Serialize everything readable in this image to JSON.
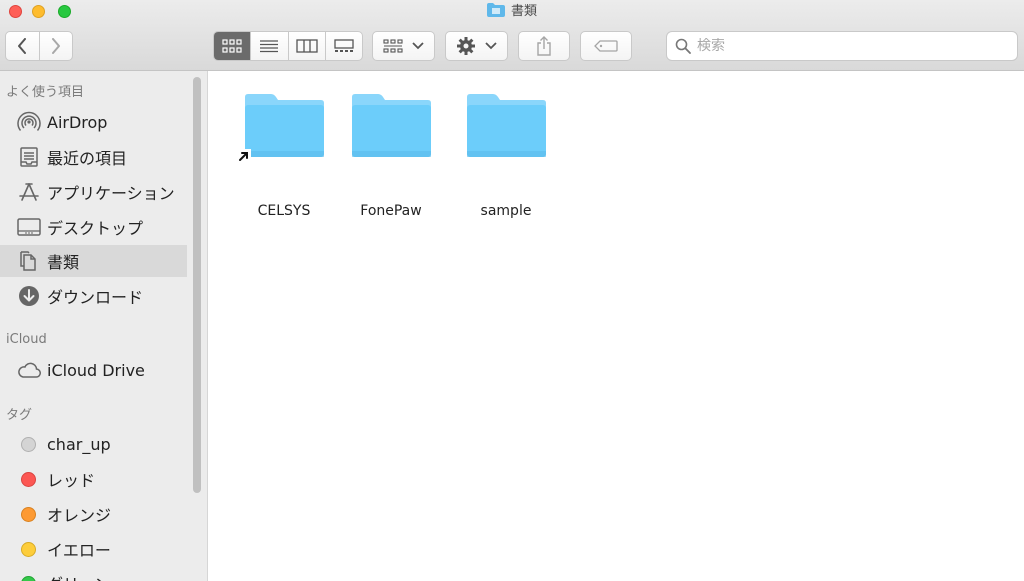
{
  "window": {
    "title": "書類"
  },
  "toolbar": {
    "back_icon": "chevron-left-icon",
    "forward_icon": "chevron-right-icon",
    "views": [
      "icon-view",
      "list-view",
      "column-view",
      "gallery-view"
    ],
    "search_placeholder": "検索"
  },
  "sidebar": {
    "favorites_header": "よく使う項目",
    "favorites": [
      {
        "label": "AirDrop",
        "icon": "airdrop-icon"
      },
      {
        "label": "最近の項目",
        "icon": "recents-icon"
      },
      {
        "label": "アプリケーション",
        "icon": "applications-icon"
      },
      {
        "label": "デスクトップ",
        "icon": "desktop-icon"
      },
      {
        "label": "書類",
        "icon": "documents-icon",
        "selected": true
      },
      {
        "label": "ダウンロード",
        "icon": "downloads-icon"
      }
    ],
    "icloud_header": "iCloud",
    "icloud": [
      {
        "label": "iCloud Drive",
        "icon": "cloud-icon"
      }
    ],
    "tags_header": "タグ",
    "tags": [
      {
        "label": "char_up",
        "color": "#d4d4d4"
      },
      {
        "label": "レッド",
        "color": "#fc5753"
      },
      {
        "label": "オレンジ",
        "color": "#fd9a33"
      },
      {
        "label": "イエロー",
        "color": "#fdcd3b"
      },
      {
        "label": "グリーン",
        "color": "#34c84a"
      }
    ]
  },
  "files": [
    {
      "name": "CELSYS",
      "alias": true
    },
    {
      "name": "FonePaw",
      "alias": false
    },
    {
      "name": "sample",
      "alias": false
    }
  ],
  "colors": {
    "folder_body": "#6ccdfa",
    "folder_tab": "#8ad6fb",
    "selected_row": "#d9d9d9"
  }
}
